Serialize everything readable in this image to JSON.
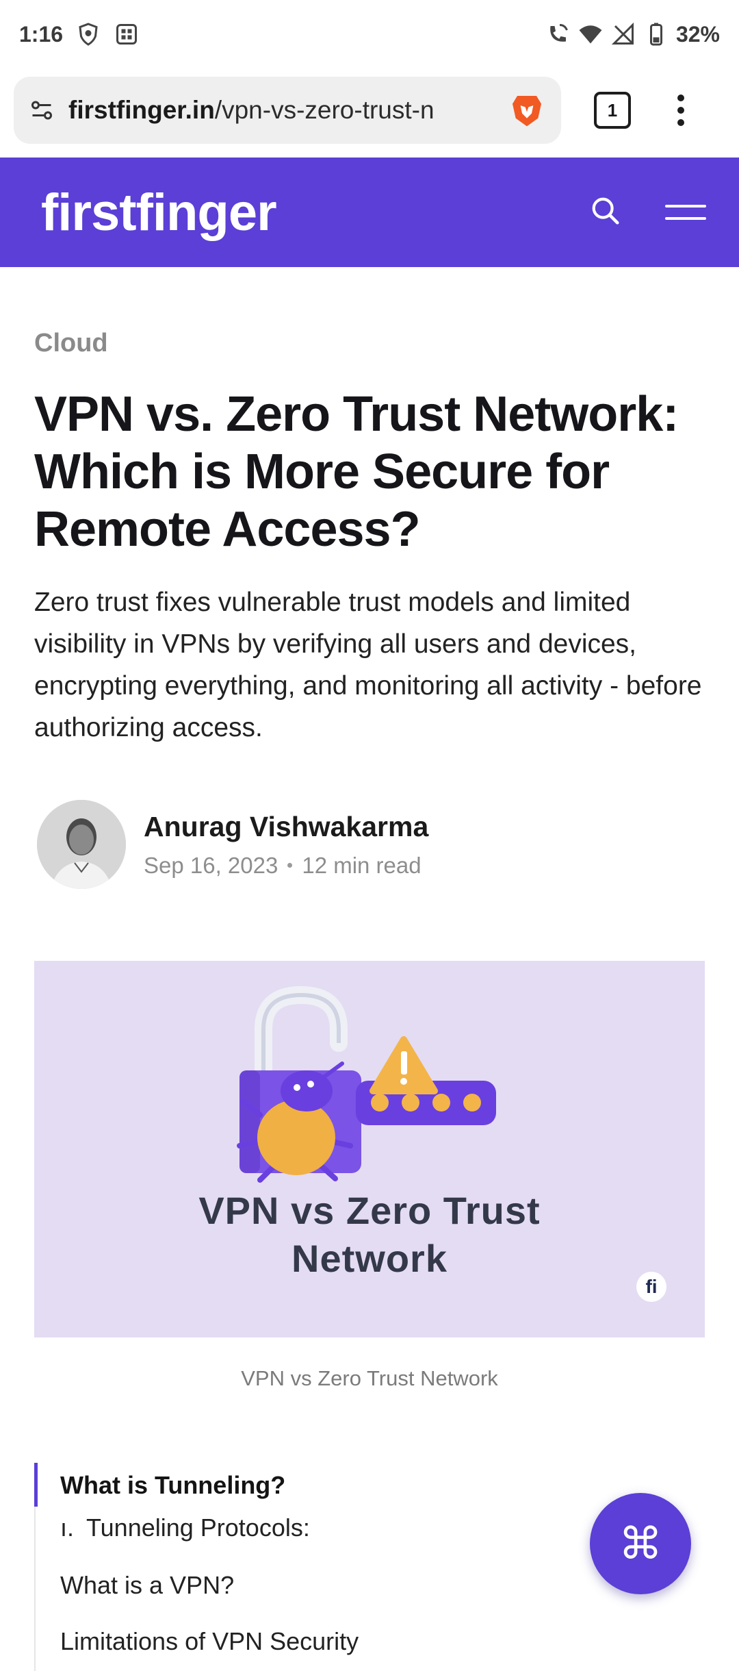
{
  "status_bar": {
    "time": "1:16",
    "battery": "32%"
  },
  "browser": {
    "url_host": "firstfinger.in",
    "url_path": "/vpn-vs-zero-trust-n",
    "tab_count": "1"
  },
  "site": {
    "logo": "firstfinger",
    "brand_color": "#5b3fd6"
  },
  "article": {
    "category": "Cloud",
    "title": "VPN vs. Zero Trust Network: Which is More Secure for Remote Access?",
    "excerpt": "Zero trust fixes vulnerable trust models and limited visibility in VPNs by verifying all users and devices, encrypting everything, and monitoring all activity - before authorizing access.",
    "author": {
      "name": "Anurag Vishwakarma",
      "date": "Sep 16, 2023",
      "read_time": "12 min read"
    },
    "hero": {
      "text_line1": "VPN vs Zero Trust",
      "text_line2": "Network",
      "badge": "fi",
      "caption": "VPN vs Zero Trust Network"
    }
  },
  "toc": {
    "items": [
      {
        "label": "What is Tunneling?",
        "active": true
      },
      {
        "label": "Tunneling Protocols:",
        "marker": "ı."
      },
      {
        "label": "What is a VPN?"
      },
      {
        "label": "Limitations of VPN Security"
      }
    ]
  },
  "fab": {
    "icon": "command-icon"
  }
}
